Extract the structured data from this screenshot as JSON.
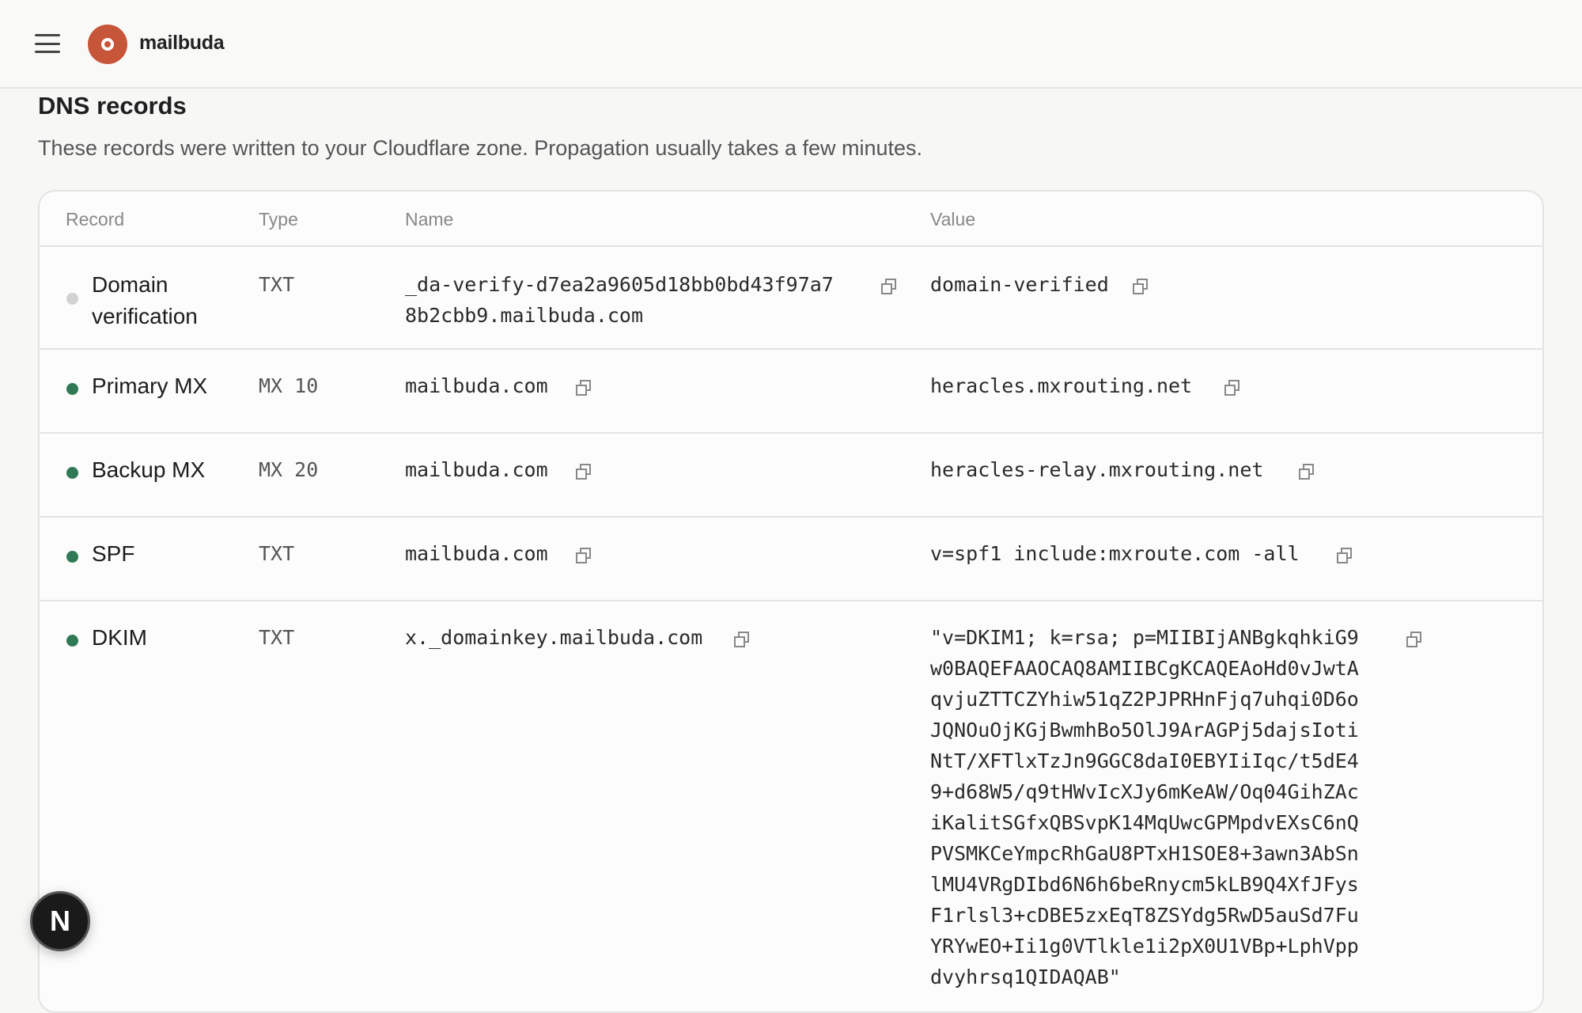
{
  "header": {
    "brand": "mailbuda"
  },
  "section": {
    "title": "DNS records",
    "subtitle": "These records were written to your Cloudflare zone. Propagation usually takes a few minutes."
  },
  "table": {
    "columns": [
      "Record",
      "Type",
      "Name",
      "Value"
    ],
    "rows": [
      {
        "record": "Domain verification",
        "status": "pending",
        "type": "TXT",
        "name_lines": [
          "_da-verify-d7ea2a9605d18bb0bd43f97a7",
          "8b2cbb9.mailbuda.com"
        ],
        "value_lines": [
          "domain-verified"
        ]
      },
      {
        "record": "Primary MX",
        "status": "active",
        "type": "MX 10",
        "name_lines": [
          "mailbuda.com"
        ],
        "value_lines": [
          "heracles.mxrouting.net"
        ]
      },
      {
        "record": "Backup MX",
        "status": "active",
        "type": "MX 20",
        "name_lines": [
          "mailbuda.com"
        ],
        "value_lines": [
          "heracles-relay.mxrouting.net"
        ]
      },
      {
        "record": "SPF",
        "status": "active",
        "type": "TXT",
        "name_lines": [
          "mailbuda.com"
        ],
        "value_lines": [
          "v=spf1 include:mxroute.com -all"
        ]
      },
      {
        "record": "DKIM",
        "status": "active",
        "type": "TXT",
        "name_lines": [
          "x._domainkey.mailbuda.com"
        ],
        "value_lines": [
          "\"v=DKIM1; k=rsa; p=MIIBIjANBgkqhkiG9",
          "w0BAQEFAAOCAQ8AMIIBCgKCAQEAoHd0vJwtA",
          "qvjuZTTCZYhiw51qZ2PJPRHnFjq7uhqi0D6o",
          "JQNOuOjKGjBwmhBo5OlJ9ArAGPj5dajsIoti",
          "NtT/XFTlxTzJn9GGC8daI0EBYIiIqc/t5dE4",
          "9+d68W5/q9tHWvIcXJy6mKeAW/Oq04GihZAc",
          "iKalitSGfxQBSvpK14MqUwcGPMpdvEXsC6nQ",
          "PVSMKCeYmpcRhGaU8PTxH1SOE8+3awn3AbSn",
          "lMU4VRgDIbd6N6h6beRnycm5kLB9Q4XfJFys",
          "F1rlsl3+cDBE5zxEqT8ZSYdg5RwD5auSd7Fu",
          "YRYwEO+Ii1g0VTlkle1i2pX0U1VBp+LphVpp",
          "dvyhrsq1QIDAQAB\""
        ]
      }
    ]
  },
  "fab": {
    "letter": "N"
  },
  "colors": {
    "active_dot": "#2f7a55",
    "pending_dot": "#d2d2d2",
    "brand": "#c7553a"
  },
  "icons": {
    "copy": "copy-icon",
    "menu": "hamburger-menu-icon"
  }
}
